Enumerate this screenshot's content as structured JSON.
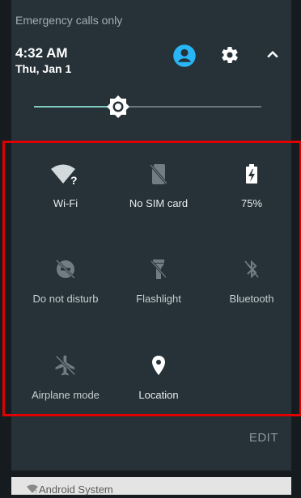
{
  "status_bar": {
    "carrier_text": "Emergency calls only"
  },
  "header": {
    "time": "4:32 AM",
    "date": "Thu, Jan 1",
    "icons": [
      "account-icon",
      "settings-icon",
      "collapse-icon"
    ]
  },
  "brightness": {
    "level_fraction": 0.26
  },
  "tiles": [
    {
      "label": "Wi-Fi",
      "icon": "wifi-question-icon"
    },
    {
      "label": "No SIM card",
      "icon": "no-sim-icon"
    },
    {
      "label": "75%",
      "icon": "battery-charging-icon"
    },
    {
      "label": "Do not disturb",
      "icon": "do-not-disturb-off-icon"
    },
    {
      "label": "Flashlight",
      "icon": "flashlight-off-icon"
    },
    {
      "label": "Bluetooth",
      "icon": "bluetooth-off-icon"
    },
    {
      "label": "Airplane mode",
      "icon": "airplane-off-icon"
    },
    {
      "label": "Location",
      "icon": "location-icon"
    }
  ],
  "edit_label": "EDIT",
  "notification": {
    "label": "Android System",
    "icon": "wifi-question-icon"
  },
  "colors": {
    "panel": "#263238",
    "accent": "#80cbc4",
    "account_icon": "#29b6f6",
    "highlight": "#e00000"
  }
}
